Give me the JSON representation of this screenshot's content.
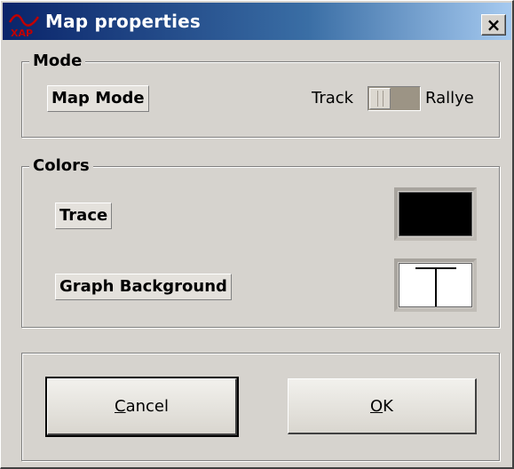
{
  "window": {
    "title": "Map properties",
    "close_label": "×"
  },
  "mode_group": {
    "title": "Mode",
    "map_mode_label": "Map Mode",
    "toggle": {
      "left_label": "Track",
      "right_label": "Rallye",
      "selected": "Track"
    }
  },
  "colors_group": {
    "title": "Colors",
    "trace_label": "Trace",
    "trace_color": "#000000",
    "bg_label": "Graph Background",
    "bg_color": "#ffffff"
  },
  "buttons": {
    "cancel_first": "C",
    "cancel_rest": "ancel",
    "ok_first": "O",
    "ok_rest": "K"
  }
}
